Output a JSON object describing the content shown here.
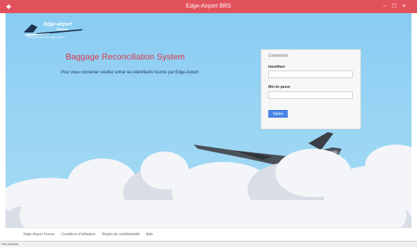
{
  "window": {
    "title": "Edge-Airport BRS",
    "app_icon": "wing-app-icon",
    "controls": [
      "–",
      "☐",
      "✕"
    ],
    "frame_color": "#e2525d"
  },
  "logo": {
    "brand_line1": "Edge-airport",
    "brand_line2": "France",
    "tagline": "Travel better with edge airport"
  },
  "main": {
    "app_title": "Baggage Reconciliation System",
    "intro": "Pour vous connecter veuillez entrer les identifiants fournis par Edge-Airport",
    "title_color": "#d9364b"
  },
  "login": {
    "title": "Connexion",
    "user_label": "Identifiant",
    "user_value": "",
    "password_label": "Mot de passe",
    "password_value": "",
    "submit_label": "Valider",
    "accent": "#4a86e8"
  },
  "footer": {
    "links": [
      "Edge-Airport France",
      "Conditions d'utilisation",
      "Règles de confidentialité",
      "Aide"
    ]
  },
  "statusbar": {
    "text": "Prêt (Loaded)"
  }
}
